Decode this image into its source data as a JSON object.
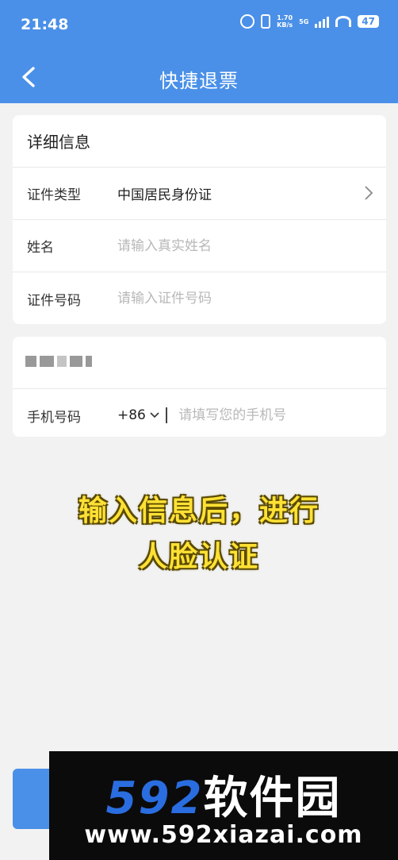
{
  "status": {
    "time": "21:48",
    "speed_top": "1.70",
    "speed_bottom": "KB/s",
    "network": "5G",
    "battery": "47"
  },
  "nav": {
    "title": "快捷退票",
    "back_icon": "chevron-left-icon"
  },
  "details_card": {
    "section_title": "详细信息",
    "rows": [
      {
        "label": "证件类型",
        "value": "中国居民身份证"
      },
      {
        "label": "姓名",
        "placeholder": "请输入真实姓名"
      },
      {
        "label": "证件号码",
        "placeholder": "请输入证件号码"
      }
    ]
  },
  "phone_card": {
    "label": "手机号码",
    "country_code": "+86",
    "placeholder": "请填写您的手机号"
  },
  "caption": {
    "line1": "输入信息后，进行",
    "line2": "人脸认证"
  },
  "watermark": {
    "logo_number": "592",
    "logo_text": "软件园",
    "url": "www.592xiazai.com"
  },
  "colors": {
    "primary": "#4a90e8",
    "caption": "#ffe135",
    "watermark_blue": "#2a6de0"
  }
}
